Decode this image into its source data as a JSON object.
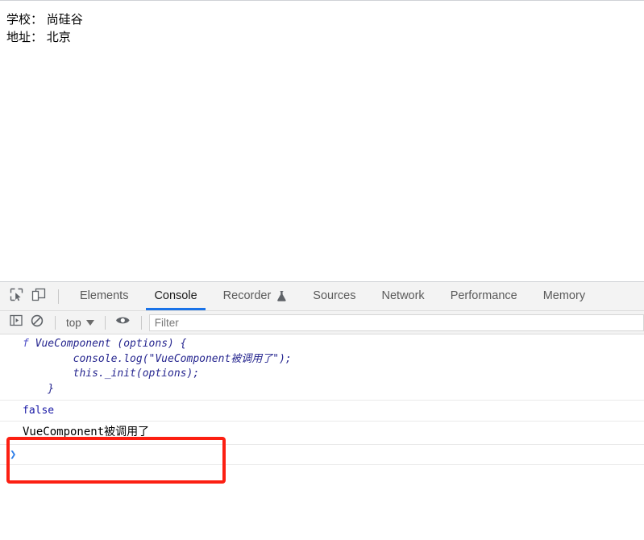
{
  "page": {
    "lines": [
      "学校： 尚硅谷",
      "地址： 北京"
    ]
  },
  "devtools": {
    "tabbar": {
      "inspect_icon": "inspect-element-icon",
      "device_icon": "device-toolbar-icon",
      "tabs": [
        {
          "label": "Elements",
          "active": false,
          "icon": ""
        },
        {
          "label": "Console",
          "active": true,
          "icon": ""
        },
        {
          "label": "Recorder",
          "active": false,
          "icon": "flask-icon"
        },
        {
          "label": "Sources",
          "active": false,
          "icon": ""
        },
        {
          "label": "Network",
          "active": false,
          "icon": ""
        },
        {
          "label": "Performance",
          "active": false,
          "icon": ""
        },
        {
          "label": "Memory",
          "active": false,
          "icon": ""
        }
      ]
    },
    "console_toolbar": {
      "sidebar_toggle_icon": "console-sidebar-icon",
      "clear_icon": "clear-console-icon",
      "context_label": "top",
      "context_caret_icon": "chevron-down-icon",
      "eye_icon": "live-expression-eye-icon",
      "filter_placeholder": "Filter",
      "filter_value": ""
    },
    "console_messages": [
      {
        "type": "function",
        "keyword": "f",
        "lines": [
          " VueComponent (options) {",
          "        console.log(\"VueComponent被调用了\");",
          "        this._init(options);",
          "    }"
        ]
      },
      {
        "type": "boolean",
        "text": "false"
      },
      {
        "type": "log",
        "text": "VueComponent被调用了"
      }
    ],
    "prompt": {
      "caret": "❯",
      "value": ""
    }
  },
  "annotation": {
    "color": "#fc1f12",
    "label": "highlight-box"
  }
}
